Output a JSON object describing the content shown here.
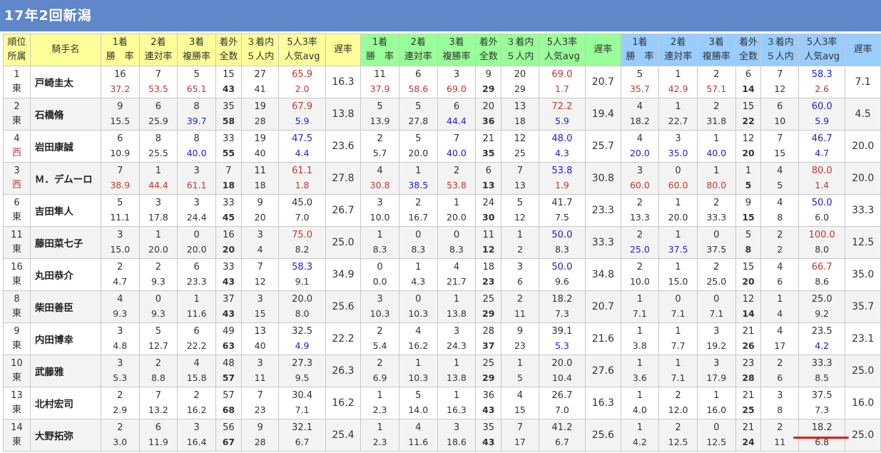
{
  "title": "17年2回新潟",
  "header": {
    "rank_top": "順位",
    "rank_bottom": "所属",
    "name": "騎手名",
    "groups": [
      {
        "cols": [
          [
            "1着",
            "勝　率"
          ],
          [
            "2着",
            "連対率"
          ],
          [
            "3着",
            "複勝率"
          ],
          [
            "着外",
            "全数"
          ],
          [
            "３着内",
            "５人内"
          ],
          [
            "5人3率",
            "人気avg"
          ],
          [
            "遅率",
            ""
          ]
        ]
      },
      {
        "cols": [
          [
            "1着",
            "勝　率"
          ],
          [
            "2着",
            "連対率"
          ],
          [
            "3着",
            "複勝率"
          ],
          [
            "着外",
            "全数"
          ],
          [
            "３着内",
            "５人内"
          ],
          [
            "5人3率",
            "人気avg"
          ],
          [
            "遅率",
            ""
          ]
        ]
      },
      {
        "cols": [
          [
            "1着",
            "勝　率"
          ],
          [
            "2着",
            "連対率"
          ],
          [
            "3着",
            "複勝率"
          ],
          [
            "着外",
            "全数"
          ],
          [
            "３着内",
            "５人内"
          ],
          [
            "5人3率",
            "人気avg"
          ],
          [
            "遅率",
            ""
          ]
        ]
      }
    ]
  },
  "colors": {
    "title_bg": "#5f87c9",
    "yellow": "#ffff99",
    "green": "#99ff99",
    "blue": "#99ccff",
    "red": "#c0392b",
    "blue_text": "#1f22c8"
  },
  "rows": [
    {
      "rank": "1",
      "aff": "東",
      "name": "戸崎圭太",
      "g": [
        [
          [
            "16",
            "37.2",
            "r"
          ],
          [
            "7",
            "53.5",
            "r"
          ],
          [
            "5",
            "65.1",
            "r"
          ],
          [
            "15",
            "43"
          ],
          [
            "27",
            "41"
          ],
          [
            "65.9",
            "2.0",
            "rr"
          ],
          [
            "16.3"
          ]
        ],
        [
          [
            "11",
            "37.9",
            "r"
          ],
          [
            "6",
            "58.6",
            "r"
          ],
          [
            "3",
            "69.0",
            "r"
          ],
          [
            "9",
            "29"
          ],
          [
            "20",
            "29"
          ],
          [
            "69.0",
            "1.7",
            "rr"
          ],
          [
            "20.7"
          ]
        ],
        [
          [
            "5",
            "35.7",
            "r"
          ],
          [
            "1",
            "42.9",
            "r"
          ],
          [
            "2",
            "57.1",
            "r"
          ],
          [
            "6",
            "14"
          ],
          [
            "7",
            "12"
          ],
          [
            "58.3",
            "2.6",
            "br"
          ],
          [
            "7.1"
          ]
        ]
      ]
    },
    {
      "rank": "2",
      "aff": "東",
      "name": "石橋脩",
      "g": [
        [
          [
            "9",
            "15.5"
          ],
          [
            "6",
            "25.9"
          ],
          [
            "8",
            "39.7",
            "b"
          ],
          [
            "35",
            "58"
          ],
          [
            "19",
            "28"
          ],
          [
            "67.9",
            "5.9",
            "rb"
          ],
          [
            "13.8"
          ]
        ],
        [
          [
            "5",
            "13.9"
          ],
          [
            "5",
            "27.8"
          ],
          [
            "6",
            "44.4",
            "b"
          ],
          [
            "20",
            "36"
          ],
          [
            "13",
            "18"
          ],
          [
            "72.2",
            "5.9",
            "rb"
          ],
          [
            "19.4"
          ]
        ],
        [
          [
            "4",
            "18.2"
          ],
          [
            "1",
            "22.7"
          ],
          [
            "2",
            "31.8"
          ],
          [
            "15",
            "22"
          ],
          [
            "6",
            "10"
          ],
          [
            "60.0",
            "5.9",
            "bb"
          ],
          [
            "4.5"
          ]
        ]
      ]
    },
    {
      "rank": "4",
      "aff": "西",
      "name": "岩田康誠",
      "g": [
        [
          [
            "6",
            "10.9"
          ],
          [
            "8",
            "25.5"
          ],
          [
            "8",
            "40.0",
            "b"
          ],
          [
            "33",
            "55"
          ],
          [
            "19",
            "40"
          ],
          [
            "47.5",
            "4.4",
            "bb"
          ],
          [
            "23.6"
          ]
        ],
        [
          [
            "2",
            "5.7"
          ],
          [
            "5",
            "20.0"
          ],
          [
            "7",
            "40.0",
            "b"
          ],
          [
            "21",
            "35"
          ],
          [
            "12",
            "25"
          ],
          [
            "48.0",
            "4.3",
            "bb"
          ],
          [
            "25.7"
          ]
        ],
        [
          [
            "4",
            "20.0",
            "b"
          ],
          [
            "3",
            "35.0",
            "b"
          ],
          [
            "1",
            "40.0",
            "b"
          ],
          [
            "12",
            "20"
          ],
          [
            "7",
            "15"
          ],
          [
            "46.7",
            "4.7",
            "bb"
          ],
          [
            "20.0"
          ]
        ]
      ]
    },
    {
      "rank": "3",
      "aff": "西",
      "name": "Ｍ．デムーロ",
      "g": [
        [
          [
            "7",
            "38.9",
            "r"
          ],
          [
            "1",
            "44.4",
            "r"
          ],
          [
            "3",
            "61.1",
            "r"
          ],
          [
            "7",
            "18"
          ],
          [
            "11",
            "18"
          ],
          [
            "61.1",
            "1.8",
            "rr"
          ],
          [
            "27.8"
          ]
        ],
        [
          [
            "4",
            "30.8",
            "r"
          ],
          [
            "1",
            "38.5",
            "b"
          ],
          [
            "2",
            "53.8",
            "r"
          ],
          [
            "6",
            "13"
          ],
          [
            "7",
            "13"
          ],
          [
            "53.8",
            "1.9",
            "br"
          ],
          [
            "30.8"
          ]
        ],
        [
          [
            "3",
            "60.0",
            "r"
          ],
          [
            "0",
            "60.0",
            "r"
          ],
          [
            "1",
            "80.0",
            "r"
          ],
          [
            "1",
            "5"
          ],
          [
            "4",
            "5"
          ],
          [
            "80.0",
            "1.4",
            "rr"
          ],
          [
            "20.0"
          ]
        ]
      ]
    },
    {
      "rank": "6",
      "aff": "東",
      "name": "吉田隼人",
      "g": [
        [
          [
            "5",
            "11.1"
          ],
          [
            "3",
            "17.8"
          ],
          [
            "3",
            "24.4"
          ],
          [
            "33",
            "45"
          ],
          [
            "9",
            "20"
          ],
          [
            "45.0",
            "7.0"
          ],
          [
            "26.7"
          ]
        ],
        [
          [
            "3",
            "10.0"
          ],
          [
            "2",
            "16.7"
          ],
          [
            "1",
            "20.0"
          ],
          [
            "24",
            "30"
          ],
          [
            "5",
            "12"
          ],
          [
            "41.7",
            "7.5"
          ],
          [
            "23.3"
          ]
        ],
        [
          [
            "2",
            "13.3"
          ],
          [
            "1",
            "20.0"
          ],
          [
            "2",
            "33.3"
          ],
          [
            "9",
            "15"
          ],
          [
            "4",
            "8"
          ],
          [
            "50.0",
            "6.0",
            "bn"
          ],
          [
            "33.3"
          ]
        ]
      ]
    },
    {
      "rank": "11",
      "aff": "東",
      "name": "藤田菜七子",
      "g": [
        [
          [
            "3",
            "15.0"
          ],
          [
            "1",
            "20.0"
          ],
          [
            "0",
            "20.0"
          ],
          [
            "16",
            "20"
          ],
          [
            "3",
            "4"
          ],
          [
            "75.0",
            "8.2",
            "rn"
          ],
          [
            "25.0"
          ]
        ],
        [
          [
            "1",
            "8.3"
          ],
          [
            "0",
            "8.3"
          ],
          [
            "0",
            "8.3"
          ],
          [
            "11",
            "12"
          ],
          [
            "1",
            "2"
          ],
          [
            "50.0",
            "8.3",
            "bn"
          ],
          [
            "33.3"
          ]
        ],
        [
          [
            "2",
            "25.0",
            "b"
          ],
          [
            "1",
            "37.5",
            "b"
          ],
          [
            "0",
            "37.5"
          ],
          [
            "5",
            "8"
          ],
          [
            "2",
            "2"
          ],
          [
            "100.0",
            "8.0",
            "rn"
          ],
          [
            "12.5"
          ]
        ]
      ]
    },
    {
      "rank": "16",
      "aff": "東",
      "name": "丸田恭介",
      "g": [
        [
          [
            "2",
            "4.7"
          ],
          [
            "2",
            "9.3"
          ],
          [
            "6",
            "23.3"
          ],
          [
            "33",
            "43"
          ],
          [
            "7",
            "12"
          ],
          [
            "58.3",
            "9.1",
            "bn"
          ],
          [
            "34.9"
          ]
        ],
        [
          [
            "0",
            "0.0"
          ],
          [
            "1",
            "4.3"
          ],
          [
            "4",
            "21.7"
          ],
          [
            "18",
            "23"
          ],
          [
            "3",
            "6"
          ],
          [
            "50.0",
            "9.6",
            "bn"
          ],
          [
            "34.8"
          ]
        ],
        [
          [
            "2",
            "10.0"
          ],
          [
            "1",
            "15.0"
          ],
          [
            "2",
            "25.0"
          ],
          [
            "15",
            "20"
          ],
          [
            "4",
            "6"
          ],
          [
            "66.7",
            "8.6",
            "rn"
          ],
          [
            "35.0"
          ]
        ]
      ]
    },
    {
      "rank": "8",
      "aff": "東",
      "name": "柴田善臣",
      "g": [
        [
          [
            "4",
            "9.3"
          ],
          [
            "0",
            "9.3"
          ],
          [
            "1",
            "11.6"
          ],
          [
            "37",
            "43"
          ],
          [
            "3",
            "15"
          ],
          [
            "20.0",
            "8.0"
          ],
          [
            "25.6"
          ]
        ],
        [
          [
            "3",
            "10.3"
          ],
          [
            "0",
            "10.3"
          ],
          [
            "1",
            "13.8"
          ],
          [
            "25",
            "29"
          ],
          [
            "2",
            "11"
          ],
          [
            "18.2",
            "7.3"
          ],
          [
            "20.7"
          ]
        ],
        [
          [
            "1",
            "7.1"
          ],
          [
            "0",
            "7.1"
          ],
          [
            "0",
            "7.1"
          ],
          [
            "12",
            "14"
          ],
          [
            "1",
            "4"
          ],
          [
            "25.0",
            "9.2"
          ],
          [
            "35.7"
          ]
        ]
      ]
    },
    {
      "rank": "9",
      "aff": "東",
      "name": "内田博幸",
      "g": [
        [
          [
            "3",
            "4.8"
          ],
          [
            "5",
            "12.7"
          ],
          [
            "6",
            "22.2"
          ],
          [
            "49",
            "63"
          ],
          [
            "13",
            "40"
          ],
          [
            "32.5",
            "4.9",
            "nb"
          ],
          [
            "22.2"
          ]
        ],
        [
          [
            "2",
            "5.4"
          ],
          [
            "4",
            "16.2"
          ],
          [
            "3",
            "24.3"
          ],
          [
            "28",
            "37"
          ],
          [
            "9",
            "23"
          ],
          [
            "39.1",
            "5.3",
            "nb"
          ],
          [
            "21.6"
          ]
        ],
        [
          [
            "1",
            "3.8"
          ],
          [
            "1",
            "7.7"
          ],
          [
            "3",
            "19.2"
          ],
          [
            "21",
            "26"
          ],
          [
            "4",
            "17"
          ],
          [
            "23.5",
            "4.2",
            "nb"
          ],
          [
            "23.1"
          ]
        ]
      ]
    },
    {
      "rank": "10",
      "aff": "東",
      "name": "武藤雅",
      "g": [
        [
          [
            "3",
            "5.3"
          ],
          [
            "2",
            "8.8"
          ],
          [
            "4",
            "15.8"
          ],
          [
            "48",
            "57"
          ],
          [
            "3",
            "11"
          ],
          [
            "27.3",
            "9.5"
          ],
          [
            "26.3"
          ]
        ],
        [
          [
            "2",
            "6.9"
          ],
          [
            "1",
            "10.3"
          ],
          [
            "1",
            "13.8"
          ],
          [
            "25",
            "29"
          ],
          [
            "1",
            "5"
          ],
          [
            "20.0",
            "10.4"
          ],
          [
            "27.6"
          ]
        ],
        [
          [
            "1",
            "3.6"
          ],
          [
            "1",
            "7.1"
          ],
          [
            "3",
            "17.9"
          ],
          [
            "23",
            "28"
          ],
          [
            "2",
            "6"
          ],
          [
            "33.3",
            "8.5"
          ],
          [
            "25.0"
          ]
        ]
      ]
    },
    {
      "rank": "13",
      "aff": "東",
      "name": "北村宏司",
      "g": [
        [
          [
            "2",
            "2.9"
          ],
          [
            "7",
            "13.2"
          ],
          [
            "2",
            "16.2"
          ],
          [
            "57",
            "68"
          ],
          [
            "7",
            "23"
          ],
          [
            "30.4",
            "7.1"
          ],
          [
            "16.2"
          ]
        ],
        [
          [
            "1",
            "2.3"
          ],
          [
            "5",
            "14.0"
          ],
          [
            "1",
            "16.3"
          ],
          [
            "36",
            "43"
          ],
          [
            "4",
            "15"
          ],
          [
            "26.7",
            "7.0"
          ],
          [
            "16.3"
          ]
        ],
        [
          [
            "1",
            "4.0"
          ],
          [
            "2",
            "12.0"
          ],
          [
            "1",
            "16.0"
          ],
          [
            "21",
            "25"
          ],
          [
            "3",
            "8"
          ],
          [
            "37.5",
            "7.3"
          ],
          [
            "16.0"
          ]
        ]
      ]
    },
    {
      "rank": "14",
      "aff": "東",
      "name": "大野拓弥",
      "g": [
        [
          [
            "2",
            "3.0"
          ],
          [
            "6",
            "11.9"
          ],
          [
            "3",
            "16.4"
          ],
          [
            "56",
            "67"
          ],
          [
            "9",
            "28"
          ],
          [
            "32.1",
            "6.7"
          ],
          [
            "25.4"
          ]
        ],
        [
          [
            "1",
            "2.3"
          ],
          [
            "4",
            "11.6"
          ],
          [
            "3",
            "18.6"
          ],
          [
            "35",
            "43"
          ],
          [
            "7",
            "17"
          ],
          [
            "41.2",
            "6.7"
          ],
          [
            "25.6"
          ]
        ],
        [
          [
            "1",
            "4.2"
          ],
          [
            "2",
            "12.5"
          ],
          [
            "0",
            "12.5"
          ],
          [
            "21",
            "24"
          ],
          [
            "2",
            "11"
          ],
          [
            "18.2",
            "6.8"
          ],
          [
            "25.0"
          ]
        ]
      ]
    }
  ]
}
